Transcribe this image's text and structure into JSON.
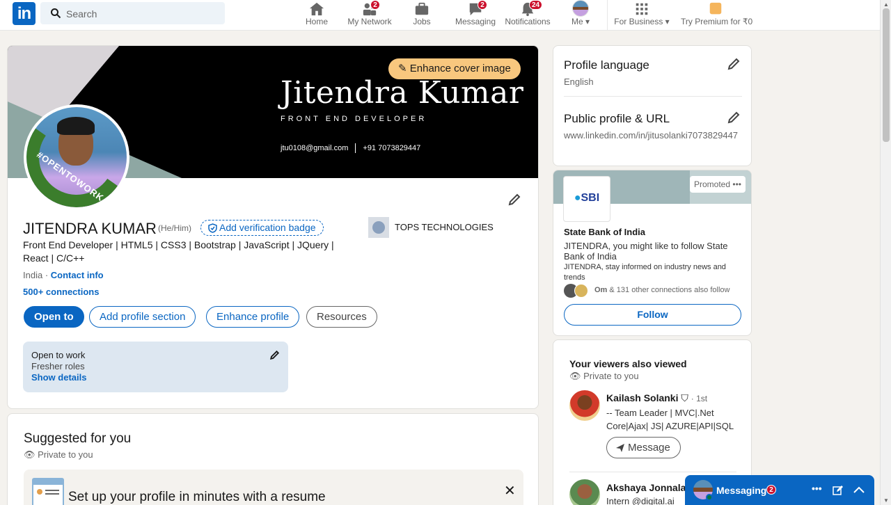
{
  "nav": {
    "search_placeholder": "Search",
    "items": [
      {
        "label": "Home",
        "icon": "home-icon"
      },
      {
        "label": "My Network",
        "icon": "network-icon",
        "badge": "2"
      },
      {
        "label": "Jobs",
        "icon": "briefcase-icon"
      },
      {
        "label": "Messaging",
        "icon": "chat-icon",
        "badge": "2"
      },
      {
        "label": "Notifications",
        "icon": "bell-icon",
        "badge": "24"
      },
      {
        "label": "Me",
        "icon": "avatar"
      },
      {
        "label": "For Business",
        "icon": "grid-icon"
      },
      {
        "label": "Try Premium for ₹0",
        "icon": "premium-icon"
      }
    ]
  },
  "cover": {
    "name": "Jitendra Kumar",
    "title": "FRONT END DEVELOPER",
    "email": "jtu0108@gmail.com",
    "phone": "+91 7073829447",
    "enhance_label": "Enhance cover image"
  },
  "profile": {
    "open_to_work_badge": "#OPENTOWORK",
    "name": "JITENDRA KUMAR",
    "pronouns": "(He/Him)",
    "verify_label": "Add verification badge",
    "headline": "Front End Developer | HTML5 | CSS3 | Bootstrap | JavaScript | JQuery | React | C/C++",
    "location": "India",
    "location_sep": " · ",
    "contact_label": "Contact info",
    "connections": "500+ connections",
    "company": "TOPS TECHNOLOGIES",
    "buttons": {
      "open_to": "Open to",
      "add_section": "Add profile section",
      "enhance": "Enhance profile",
      "resources": "Resources"
    },
    "open_to_work": {
      "title": "Open to work",
      "roles": "Fresher roles",
      "details": "Show details"
    }
  },
  "suggested": {
    "title": "Suggested for you",
    "privacy": "Private to you",
    "resume_title": "Set up your profile in minutes with a resume"
  },
  "right": {
    "profile_language": {
      "title": "Profile language",
      "value": "English"
    },
    "public_profile": {
      "title": "Public profile & URL",
      "url": "www.linkedin.com/in/jitusolanki7073829447"
    },
    "promo": {
      "promoted": "Promoted",
      "logo": "SBI",
      "company": "State Bank of India",
      "line1": "JITENDRA, you might like to follow State Bank of India",
      "line2": "JITENDRA, stay informed on industry news and trends",
      "mutual_name": "Om",
      "mutual_rest": " & 131 other connections also follow",
      "follow": "Follow"
    },
    "viewers": {
      "title": "Your viewers also viewed",
      "privacy": "Private to you",
      "people": [
        {
          "name": "Kailash Solanki",
          "degree": "· 1st",
          "headline": "-- Team Leader | MVC|.Net Core|Ajax| JS| AZURE|API|SQL",
          "action": "Message"
        },
        {
          "name": "Akshaya Jonnala",
          "headline": "Intern @digital.ai"
        }
      ]
    }
  },
  "messaging": {
    "label": "Messaging",
    "badge": "2"
  },
  "colors": {
    "brand": "#0a66c2",
    "badge": "#cb112d",
    "cover_button": "#f8c77e",
    "open_to_work": "#3b7d2c"
  }
}
